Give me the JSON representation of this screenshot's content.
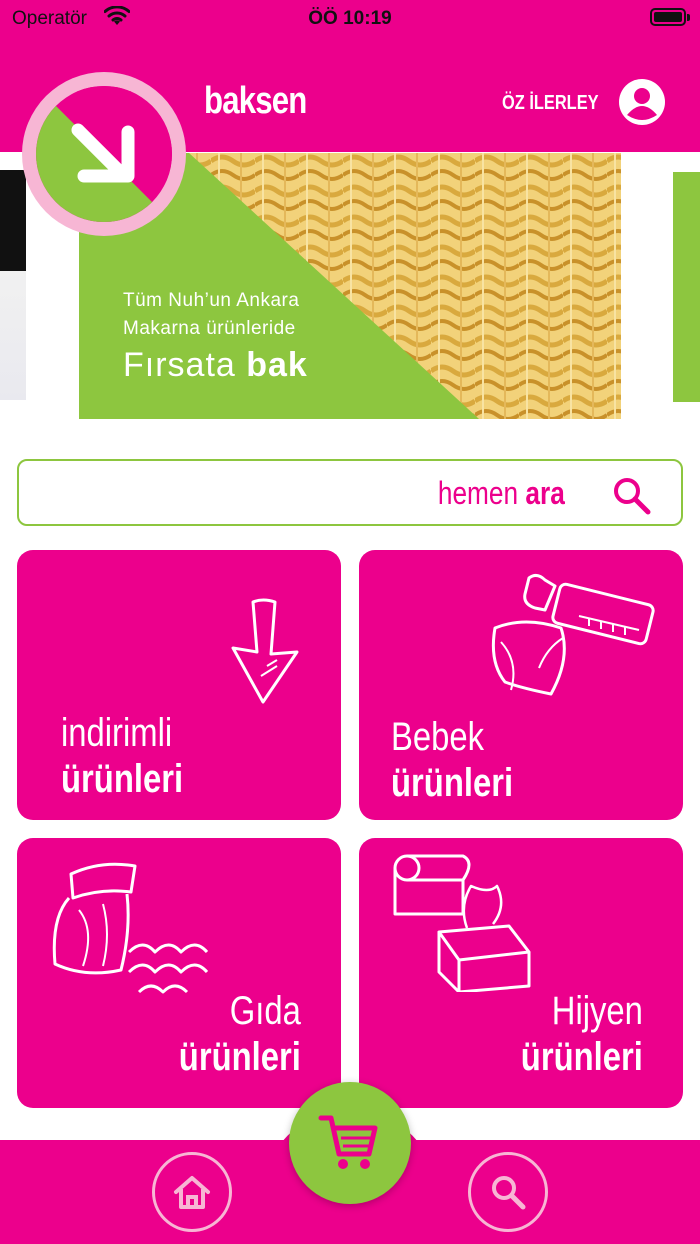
{
  "status_bar": {
    "carrier": "Operatör",
    "time": "ÖÖ 10:19",
    "battery_level": 1.0
  },
  "header": {
    "brand": "baksen",
    "user_name": "ÖZ İLERLEY",
    "profile_icon": "user-circle-icon",
    "badge_icon": "arrow-down-right-icon"
  },
  "banner": {
    "line1": "Tüm Nuh’un Ankara",
    "line2": "Makarna ürünleride",
    "line3_light": "Fırsata ",
    "line3_bold": "bak"
  },
  "search": {
    "label_light": "hemen ",
    "label_bold": "ara",
    "icon": "search-icon"
  },
  "categories": [
    {
      "thin": "indirimli",
      "bold": "ürünleri",
      "icon": "arrow-down-icon"
    },
    {
      "thin": "Bebek",
      "bold": "ürünleri",
      "icon": "baby-bottle-diaper-icon"
    },
    {
      "thin": "Gıda",
      "bold": "ürünleri",
      "icon": "food-bag-pasta-icon"
    },
    {
      "thin": "Hijyen",
      "bold": "ürünleri",
      "icon": "tissue-paper-icon"
    }
  ],
  "bottom_nav": {
    "home_icon": "home-icon",
    "cart_icon": "cart-icon",
    "search_icon": "search-icon"
  },
  "colors": {
    "brand_pink": "#ec008c",
    "accent_green": "#8dc63f",
    "light_pink": "#f7b6d4"
  }
}
